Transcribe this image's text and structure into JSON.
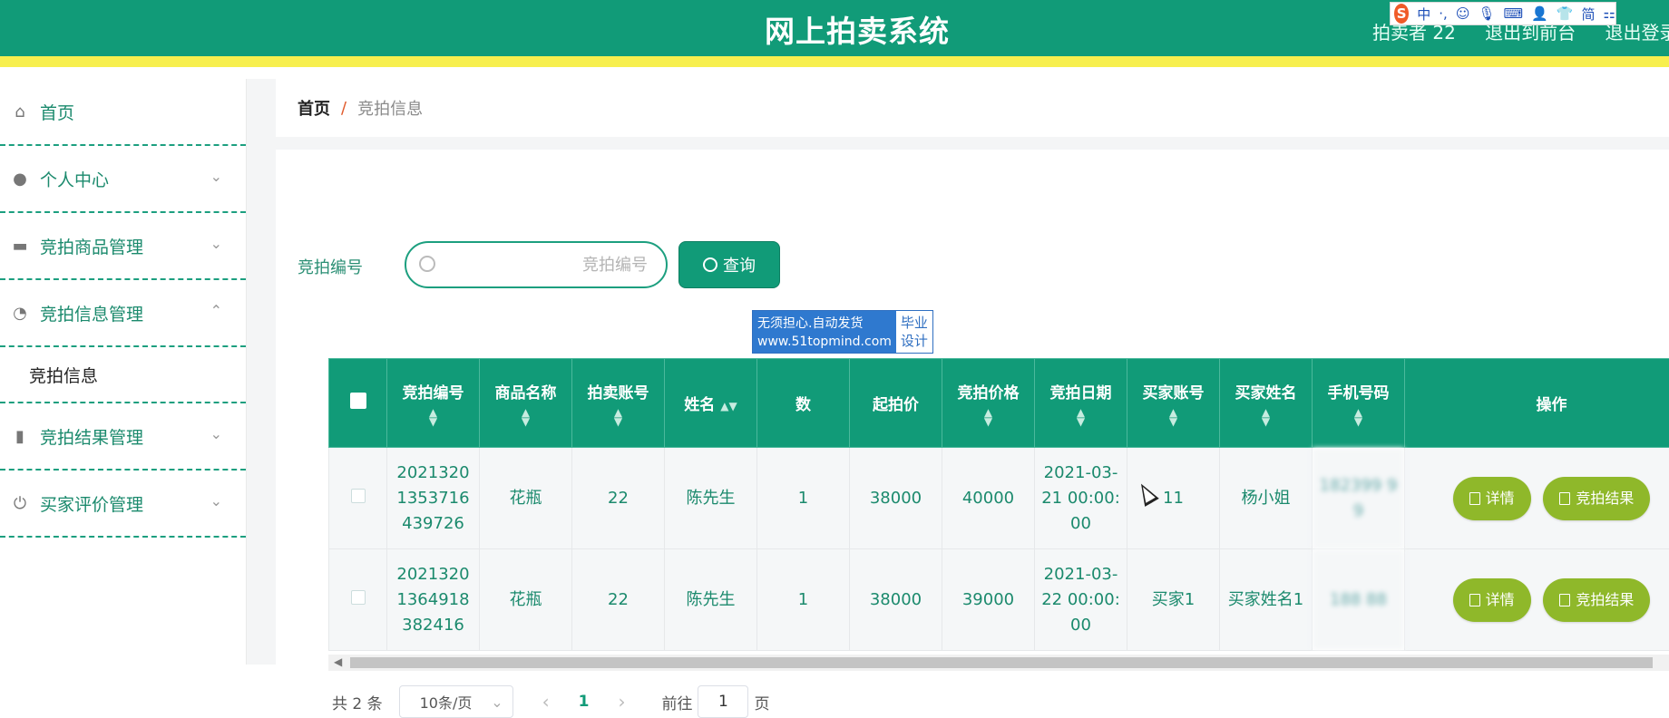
{
  "header": {
    "title": "网上拍卖系统",
    "user_label": "拍卖者 22",
    "front_link": "退出到前台",
    "logout_link": "退出登录"
  },
  "ime_toolbar": {
    "logo": "S",
    "items": [
      "中",
      "·,",
      "☺",
      "🎙",
      "⌨",
      "👤",
      "👕",
      "简",
      "⚏"
    ]
  },
  "sidebar": {
    "items": [
      {
        "label": "首页",
        "icon": "home-icon",
        "expandable": false
      },
      {
        "label": "个人中心",
        "icon": "user-icon",
        "expandable": true,
        "expanded": false
      },
      {
        "label": "竞拍商品管理",
        "icon": "briefcase-icon",
        "expandable": true,
        "expanded": false
      },
      {
        "label": "竞拍信息管理",
        "icon": "gauge-icon",
        "expandable": true,
        "expanded": true,
        "children": [
          {
            "label": "竞拍信息"
          }
        ]
      },
      {
        "label": "竞拍结果管理",
        "icon": "microphone-icon",
        "expandable": true,
        "expanded": false
      },
      {
        "label": "买家评价管理",
        "icon": "power-icon",
        "expandable": true,
        "expanded": false
      }
    ]
  },
  "breadcrumb": {
    "home": "首页",
    "separator": "/",
    "current": "竞拍信息"
  },
  "search": {
    "label": "竞拍编号",
    "placeholder": "竞拍编号",
    "value": "",
    "button": "查询"
  },
  "table": {
    "columns": [
      "竞拍编号",
      "商品名称",
      "拍卖账号",
      "姓名",
      "数",
      "起拍价",
      "竞拍价格",
      "竞拍日期",
      "买家账号",
      "买家姓名",
      "手机号码",
      "操作"
    ],
    "rows": [
      {
        "bid_no": "20213201353716439726",
        "product": "花瓶",
        "seller_account": "22",
        "name": "陈先生",
        "quantity": "1",
        "start_price": "38000",
        "bid_price": "40000",
        "bid_date": "2021-03-21 00:00:00",
        "buyer_account": "11",
        "buyer_name": "杨小姐",
        "phone": "182399 99"
      },
      {
        "bid_no": "20213201364918382416",
        "product": "花瓶",
        "seller_account": "22",
        "name": "陈先生",
        "quantity": "1",
        "start_price": "38000",
        "bid_price": "39000",
        "bid_date": "2021-03-22 00:00:00",
        "buyer_account": "买家1",
        "buyer_name": "买家姓名1",
        "phone": "188 88"
      }
    ],
    "actions": {
      "detail": "详情",
      "result": "竞拍结果"
    }
  },
  "pagination": {
    "total": "共 2 条",
    "page_size": "10条/页",
    "current_page": "1",
    "goto_label": "前往",
    "goto_value": "1",
    "page_suffix": "页"
  },
  "ad_overlay": {
    "line1": "无须担心.自动发货",
    "line2": "www.51topmind.com",
    "right1": "毕业",
    "right2": "设计"
  },
  "colors": {
    "primary": "#119b78",
    "accent_line": "#f7ef4e",
    "action_button": "#8fb82a"
  }
}
